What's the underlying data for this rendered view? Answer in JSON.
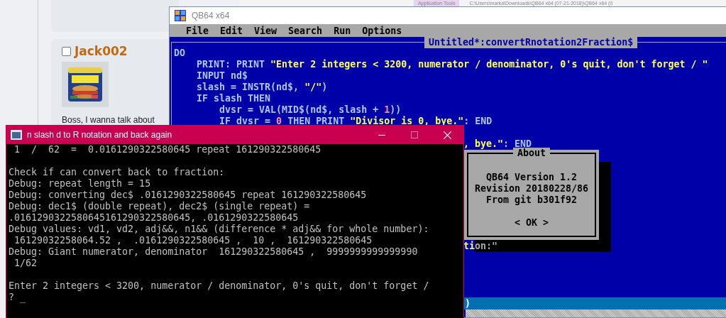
{
  "forum_page": {
    "post": {
      "checked": false,
      "author": "Jack002",
      "excerpt": "Boss, I wanna talk about"
    }
  },
  "explorer_window": {
    "ribbon_tab": "Application Tools",
    "path": "C:\\Users\\marka\\Downloads\\QB64 x64 (07-21-2018)\\QB64 x64 (0"
  },
  "qb64_window": {
    "title": "QB64 x64",
    "menu": [
      "File",
      "Edit",
      "View",
      "Search",
      "Run",
      "Options"
    ],
    "editor": {
      "title": "Untitled*:convertRnotation2Fraction$",
      "lines": [
        [
          {
            "kind": "code",
            "text": "DO"
          }
        ],
        [
          {
            "kind": "code",
            "text": "    PRINT: PRINT "
          },
          {
            "kind": "string",
            "text": "\"Enter 2 integers < 3200, numerator / denominator, 0's quit, don't forget / \""
          }
        ],
        [
          {
            "kind": "code",
            "text": "    INPUT nd$"
          }
        ],
        [
          {
            "kind": "code",
            "text": "    slash = INSTR(nd$, "
          },
          {
            "kind": "string",
            "text": "\"/\""
          },
          {
            "kind": "code",
            "text": ")"
          }
        ],
        [
          {
            "kind": "code",
            "text": "    IF slash THEN"
          }
        ],
        [
          {
            "kind": "code",
            "text": "        dvsr = VAL(MID$(nd$, slash + "
          },
          {
            "kind": "number",
            "text": "1"
          },
          {
            "kind": "code",
            "text": "))"
          }
        ],
        [
          {
            "kind": "code",
            "text": "        IF dvsr = "
          },
          {
            "kind": "number",
            "text": "0"
          },
          {
            "kind": "code",
            "text": " THEN PRINT "
          },
          {
            "kind": "string",
            "text": "\"Divisor is 0, bye.\""
          },
          {
            "kind": "code",
            "text": ": END"
          }
        ]
      ],
      "fragments": [
        [
          {
            "kind": "string",
            "text": ", bye.\""
          },
          {
            "kind": "code",
            "text": ": END"
          }
        ],
        [
          {
            "kind": "string",
            "text": "ti"
          },
          {
            "kind": "shadowed",
            "text": "on:\""
          }
        ]
      ]
    },
    "status_bar": ")"
  },
  "about_dialog": {
    "title": "About",
    "lines": [
      "QB64 Version 1.2",
      "Revision 20180228/86",
      "From git b301f92"
    ],
    "button": "< OK >"
  },
  "console_window": {
    "title": "n slash d to R notation and back again",
    "blocks": [
      [
        " 1  /  62  =  0.0161290322580645 repeat 161290322580645"
      ],
      [
        "Check if can convert back to fraction:",
        "Debug: repeat length = 15",
        "Debug: converting dec$ .0161290322580645 repeat 161290322580645",
        "Debug: dec1$ (double repeat), dec2$ (single repeat) =",
        ".0161290322580645161290322580645, .0161290322580645",
        "Debug values: vd1, vd2, adj&&, n1&& (difference * adj&& for whole number):",
        " 16129032258064.52 ,  .0161290322580645 ,  10 ,  161290322580645",
        "Debug: Giant numerator, denominator  161290322580645 ,  9999999999999990",
        " 1/62"
      ],
      [
        "Enter 2 integers < 3200, numerator / denominator, 0's quit, don't forget /",
        "? _"
      ]
    ]
  }
}
